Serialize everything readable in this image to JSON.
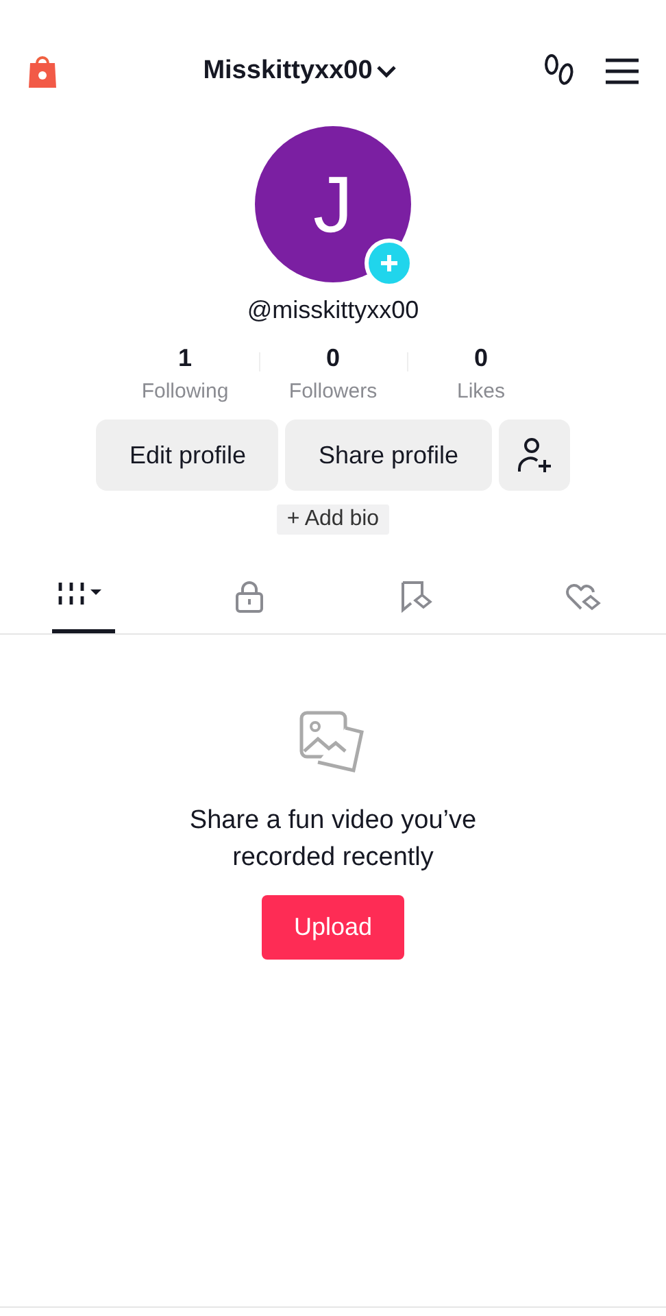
{
  "header": {
    "username": "Misskittyxx00"
  },
  "profile": {
    "avatar_letter": "J",
    "handle": "@misskittyxx00"
  },
  "stats": [
    {
      "value": "1",
      "label": "Following"
    },
    {
      "value": "0",
      "label": "Followers"
    },
    {
      "value": "0",
      "label": "Likes"
    }
  ],
  "actions": [
    "Edit profile",
    "Share profile"
  ],
  "add_bio": "+ Add bio",
  "tabs": [
    {
      "kind": "videos",
      "selected": true
    },
    {
      "kind": "private",
      "selected": false
    },
    {
      "kind": "favorites",
      "selected": false
    },
    {
      "kind": "liked",
      "selected": false
    }
  ],
  "empty_state": {
    "message": "Share a fun video you’ve recorded recently",
    "button": "Upload"
  }
}
